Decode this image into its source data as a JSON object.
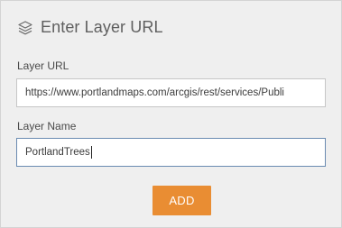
{
  "header": {
    "icon": "layers-icon",
    "title": "Enter Layer URL"
  },
  "form": {
    "url_label": "Layer URL",
    "url_value": "https://www.portlandmaps.com/arcgis/rest/services/Publi",
    "name_label": "Layer Name",
    "name_value": "PortlandTrees",
    "add_label": "ADD"
  },
  "colors": {
    "panel_bg": "#efefef",
    "accent_button": "#e98d33",
    "focus_border": "#6a8bb1"
  }
}
